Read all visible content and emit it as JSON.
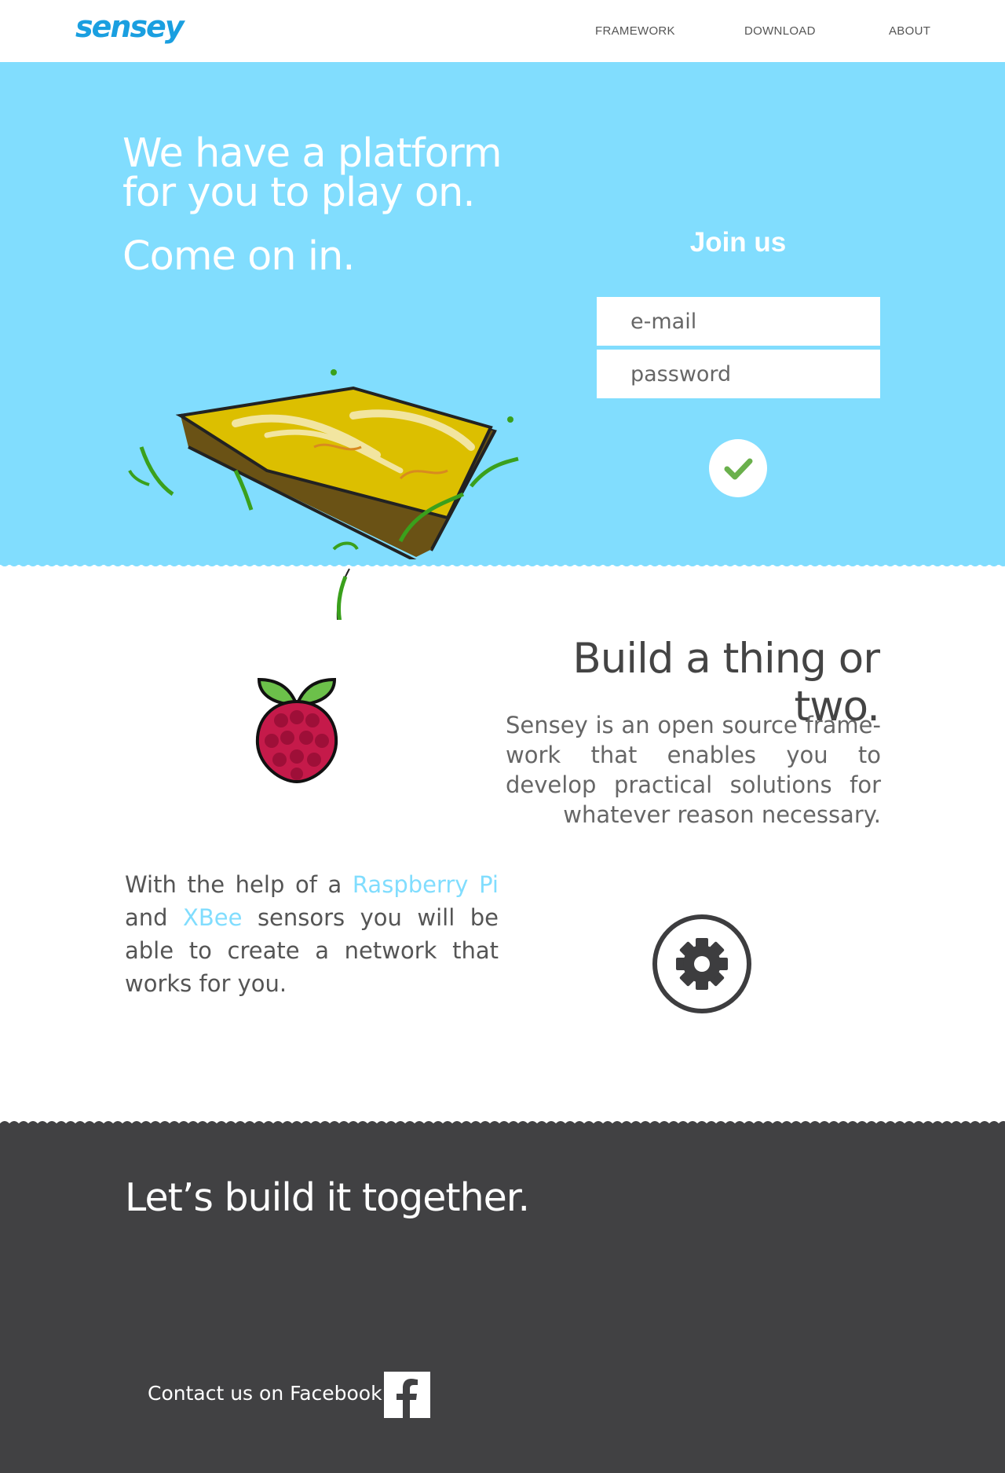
{
  "header": {
    "logo": "sensey",
    "nav": [
      {
        "label": "FRAMEWORK"
      },
      {
        "label": "DOWNLOAD"
      },
      {
        "label": "ABOUT"
      }
    ]
  },
  "hero": {
    "title": "We have a platform for you to play on.",
    "subtitle": "Come on in.",
    "join": {
      "title": "Join us",
      "email_placeholder": "e-mail",
      "password_placeholder": "password"
    }
  },
  "build": {
    "title": "Build a thing or two.",
    "text": "Sensey is an open source frame-work that enables you to develop practical solutions for whatever reason necessary.",
    "help_prefix": "With the help of a",
    "raspberry_link": "Raspberry Pi",
    "help_and": "and",
    "xbee_link": "XBee",
    "help_suffix": "sensors you will be able to create a network that works for you."
  },
  "footer": {
    "title": "Let’s build it together.",
    "contact": "Contact us on Facebook"
  },
  "colors": {
    "hero_bg": "#81ddfe",
    "footer_bg": "#414143",
    "logo": "#1a9fe0",
    "link": "#81ddfe",
    "check": "#6ab04c"
  }
}
